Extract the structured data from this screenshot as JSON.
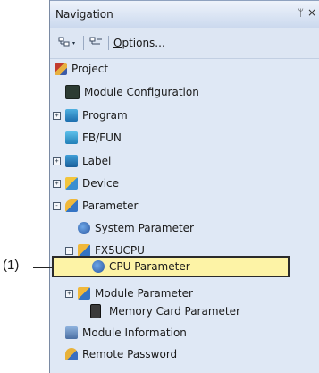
{
  "panel": {
    "title": "Navigation",
    "pin_glyph": "ᛘ",
    "close_glyph": "×"
  },
  "toolbar": {
    "options_underlined": "O",
    "options_rest": "ptions..."
  },
  "tree": [
    {
      "label": "Project",
      "icon": "project-icon"
    },
    {
      "label": "Module Configuration",
      "icon": "module-configuration-icon"
    },
    {
      "label": "Program",
      "icon": "program-icon",
      "expander": "+"
    },
    {
      "label": "FB/FUN",
      "icon": "fbfun-icon"
    },
    {
      "label": "Label",
      "icon": "label-icon",
      "expander": "+"
    },
    {
      "label": "Device",
      "icon": "device-icon",
      "expander": "+"
    },
    {
      "label": "Parameter",
      "icon": "parameter-icon",
      "expander": "-"
    },
    {
      "label": "System Parameter",
      "icon": "system-parameter-icon"
    },
    {
      "label": "FX5UCPU",
      "icon": "cpu-folder-icon",
      "expander": "-"
    },
    {
      "label": "CPU Parameter",
      "icon": "cpu-parameter-icon"
    },
    {
      "label": "Module Parameter",
      "icon": "module-parameter-icon",
      "expander": "+"
    },
    {
      "label": "Memory Card Parameter",
      "icon": "memory-card-icon"
    },
    {
      "label": "Module Information",
      "icon": "module-information-icon"
    },
    {
      "label": "Remote Password",
      "icon": "remote-password-icon"
    }
  ],
  "callout": "(1)",
  "colors": {
    "highlight": "#fdf3a6",
    "panel_bg": "#dfe8f5"
  }
}
